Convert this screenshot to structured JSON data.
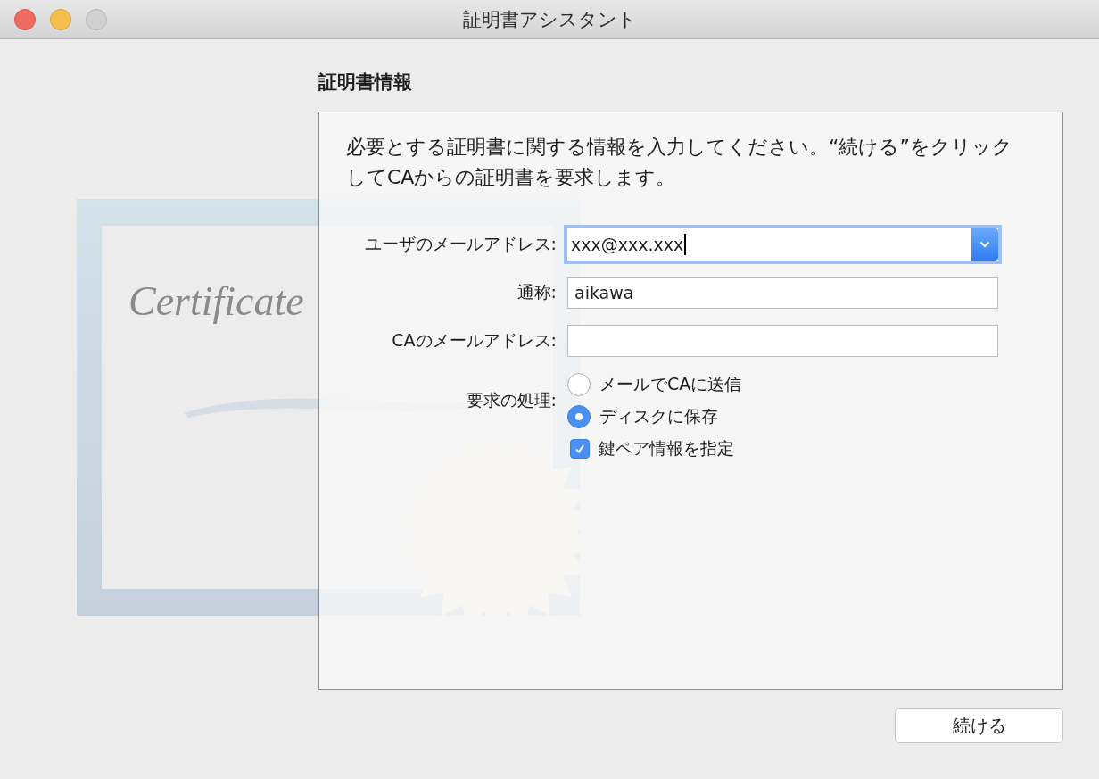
{
  "window": {
    "title": "証明書アシスタント"
  },
  "illustration": {
    "text": "Certificate"
  },
  "section": {
    "title": "証明書情報"
  },
  "instructions": "必要とする証明書に関する情報を入力してください。“続ける”をクリックしてCAからの証明書を要求します。",
  "fields": [
    {
      "label": "ユーザのメールアドレス:",
      "value": "xxx@xxx.xxx",
      "kind": "combo",
      "focused": true
    },
    {
      "label": "通称:",
      "value": "aikawa",
      "kind": "text",
      "focused": false
    },
    {
      "label": "CAのメールアドレス:",
      "kind": "text",
      "focused": false
    }
  ],
  "request": {
    "label": "要求の処理:",
    "options": [
      {
        "label": "メールでCAに送信",
        "selected": false
      },
      {
        "label": "ディスクに保存",
        "selected": true
      }
    ]
  },
  "key_pair": {
    "label": "鍵ペア情報を指定",
    "checked": true
  },
  "buttons": [
    {
      "label": "続ける"
    }
  ]
}
